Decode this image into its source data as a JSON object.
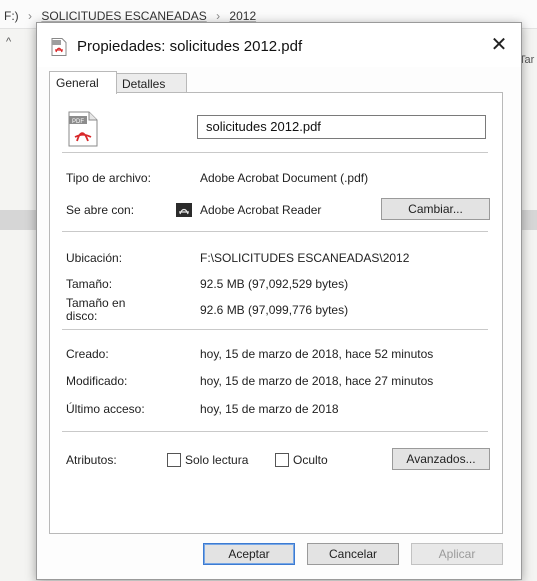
{
  "background": {
    "breadcrumb": [
      "F:)",
      "SOLICITUDES ESCANEADAS",
      "2012"
    ],
    "breadcrumb_separator": "›",
    "collapse_caret": "^",
    "partial_column_header": "Tar"
  },
  "dialog": {
    "title": "Propiedades: solicitudes 2012.pdf",
    "close_glyph": "✕",
    "tabs": [
      {
        "label": "General",
        "active": true
      },
      {
        "label": "Detalles",
        "active": false
      }
    ],
    "file_name": "solicitudes 2012.pdf",
    "file_type": {
      "label": "Tipo de archivo:",
      "value": "Adobe Acrobat Document (.pdf)"
    },
    "opens_with": {
      "label": "Se abre con:",
      "value": "Adobe Acrobat Reader",
      "change_button": "Cambiar..."
    },
    "location": {
      "label": "Ubicación:",
      "value": "F:\\SOLICITUDES ESCANEADAS\\2012"
    },
    "size": {
      "label": "Tamaño:",
      "value": "92.5 MB (97,092,529 bytes)"
    },
    "size_on_disk": {
      "label_line1": "Tamaño en",
      "label_line2": "disco:",
      "value": "92.6 MB (97,099,776 bytes)"
    },
    "created": {
      "label": "Creado:",
      "value": "hoy, 15 de marzo de 2018, hace 52 minutos"
    },
    "modified": {
      "label": "Modificado:",
      "value": "hoy, 15 de marzo de 2018, hace 27 minutos"
    },
    "accessed": {
      "label": "Último acceso:",
      "value": "hoy, 15 de marzo de 2018"
    },
    "attributes": {
      "label": "Atributos:",
      "read_only": {
        "label": "Solo lectura",
        "checked": false
      },
      "hidden": {
        "label": "Oculto",
        "checked": false
      },
      "advanced_button": "Avanzados..."
    },
    "buttons": {
      "ok": "Aceptar",
      "cancel": "Cancelar",
      "apply": "Aplicar"
    }
  },
  "colors": {
    "pdf_red": "#d8282a",
    "default_button_border": "#3d7bd1",
    "disabled_text": "#9b9b9b"
  },
  "icons": [
    "pdf-file-icon",
    "acrobat-reader-icon",
    "close-icon"
  ]
}
